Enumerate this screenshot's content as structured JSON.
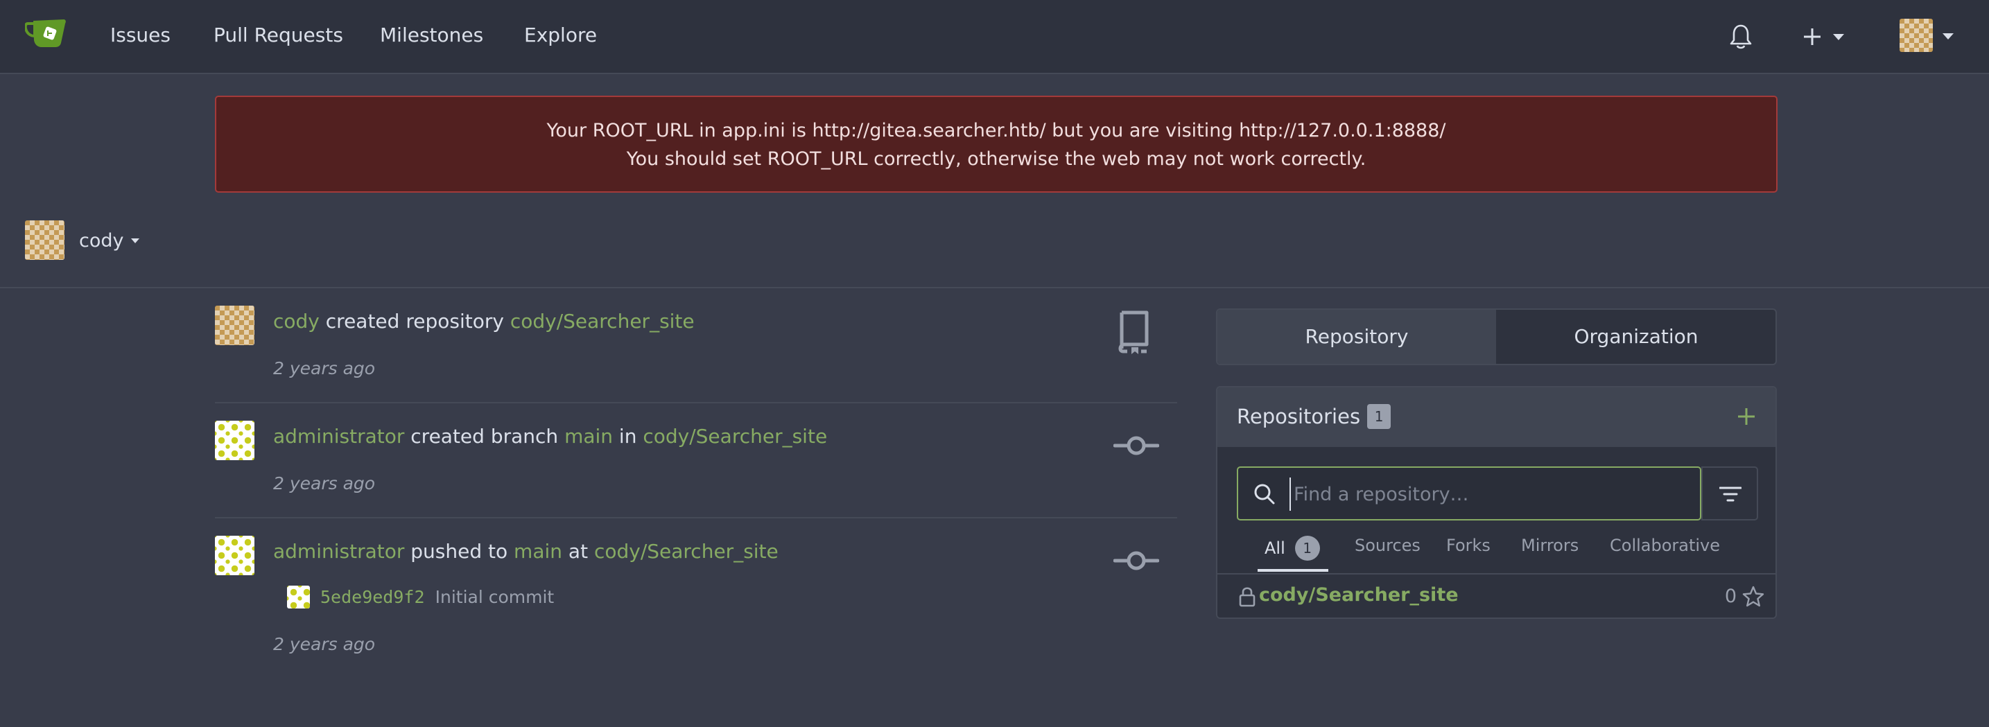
{
  "nav": {
    "items": [
      "Issues",
      "Pull Requests",
      "Milestones",
      "Explore"
    ],
    "icons": [
      "bell-icon",
      "plus-icon",
      "avatar"
    ]
  },
  "flash": {
    "line1": "Your ROOT_URL in app.ini is http://gitea.searcher.htb/ but you are visiting http://127.0.0.1:8888/",
    "line2": "You should set ROOT_URL correctly, otherwise the web may not work correctly."
  },
  "context": {
    "user": "cody"
  },
  "feed": [
    {
      "actor": "cody",
      "action": " created repository ",
      "repo": "cody/Searcher_site",
      "time": "2 years ago"
    },
    {
      "actor": "administrator",
      "action": " created branch ",
      "branch": "main",
      "connector": " in ",
      "repo": "cody/Searcher_site",
      "time": "2 years ago"
    },
    {
      "actor": "administrator",
      "action": " pushed to ",
      "branch": "main",
      "connector": " at ",
      "repo": "cody/Searcher_site",
      "commit_sha": "5ede9ed9f2",
      "commit_msg": "Initial commit",
      "time": "2 years ago"
    }
  ],
  "panel": {
    "tabs": [
      "Repository",
      "Organization"
    ],
    "title": "Repositories",
    "count": "1",
    "search_placeholder": "Find a repository…",
    "filters": [
      "All",
      "Sources",
      "Forks",
      "Mirrors",
      "Collaborative"
    ],
    "all_count": "1",
    "repos": [
      {
        "name": "cody/Searcher_site",
        "stars": "0"
      }
    ]
  },
  "colors": {
    "accent": "#87ab63",
    "bg": "#383c4a",
    "nav_bg": "#2e323e",
    "error_bg": "#522020"
  }
}
